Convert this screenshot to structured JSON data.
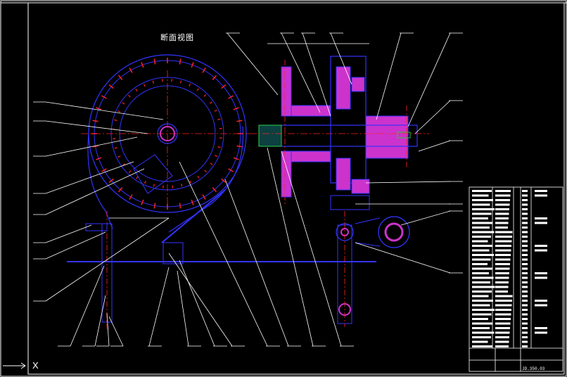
{
  "drawing": {
    "title": "断面视图",
    "ucs_axis_label": "X",
    "drawing_number": "JD.350.03"
  },
  "colors": {
    "background": "#000000",
    "frame": "#ffffff",
    "part_outline": "#3333ff",
    "section_hatch": "#cc33cc",
    "center_line": "#ff2222",
    "leader_line": "#ffffff",
    "accent_green": "#22cc22",
    "accent_yellow": "#ffff33",
    "accent_cyan": "#33ffff"
  },
  "layers": [
    "frame",
    "title-block",
    "left-view",
    "section-view",
    "leaders"
  ]
}
